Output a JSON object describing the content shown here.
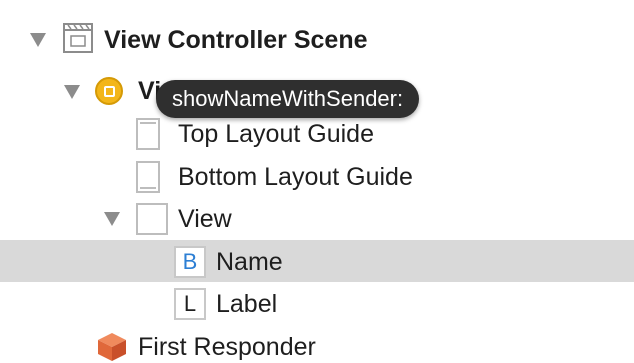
{
  "outline": {
    "scene": {
      "label": "View Controller Scene",
      "expanded": true,
      "icon": "scene-icon"
    },
    "view_controller": {
      "label": "View Controller",
      "expanded": true,
      "icon": "view-controller-icon"
    },
    "top_layout_guide": {
      "label": "Top Layout Guide",
      "icon": "layout-guide-icon"
    },
    "bottom_layout_guide": {
      "label": "Bottom Layout Guide",
      "icon": "layout-guide-icon"
    },
    "view": {
      "label": "View",
      "expanded": true,
      "icon": "view-icon"
    },
    "name_button": {
      "label": "Name",
      "icon_letter": "B",
      "selected": true
    },
    "label": {
      "label": "Label",
      "icon_letter": "L"
    },
    "first_responder": {
      "label": "First Responder",
      "icon": "cube-icon"
    }
  },
  "tooltip": {
    "text": "showNameWithSender:"
  },
  "colors": {
    "selection": "#d9d9d9",
    "view_controller_icon": "#f3b619",
    "button_letter": "#2d7fd4",
    "first_responder_icon": "#e0683a",
    "tooltip_bg": "#2f2f2f"
  }
}
